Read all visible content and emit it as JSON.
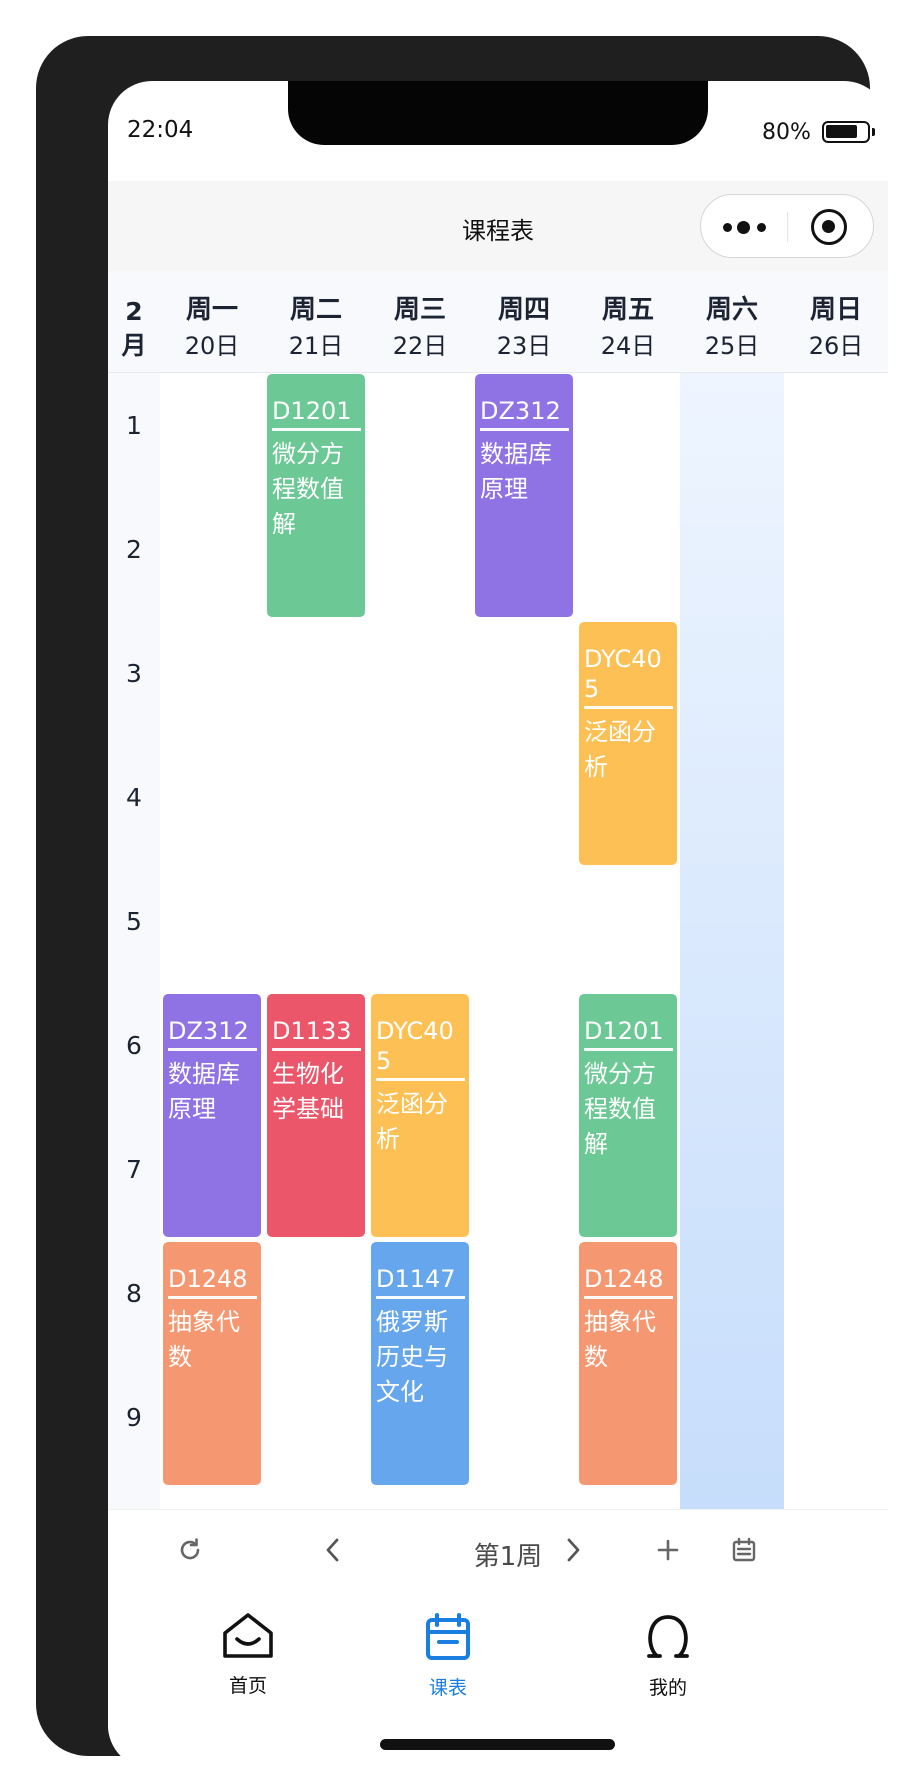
{
  "status": {
    "time": "22:04",
    "battery": "80%",
    "battery_level": 0.8
  },
  "navbar": {
    "title": "课程表"
  },
  "week_header": {
    "month": "2\n月",
    "days": [
      {
        "weekday": "周一",
        "date": "20日"
      },
      {
        "weekday": "周二",
        "date": "21日"
      },
      {
        "weekday": "周三",
        "date": "22日"
      },
      {
        "weekday": "周四",
        "date": "23日"
      },
      {
        "weekday": "周五",
        "date": "24日"
      },
      {
        "weekday": "周六",
        "date": "25日"
      },
      {
        "weekday": "周日",
        "date": "26日"
      }
    ]
  },
  "periods": [
    "1",
    "2",
    "3",
    "4",
    "5",
    "6",
    "7",
    "8",
    "9"
  ],
  "courses": [
    {
      "code": "D1201",
      "name": "微分方程数值解",
      "day": 2,
      "start": 1,
      "span": 2,
      "color": "#6cc894"
    },
    {
      "code": "DZ312",
      "name": "数据库原理",
      "day": 4,
      "start": 1,
      "span": 2,
      "color": "#8f73e4"
    },
    {
      "code": "DYC405",
      "name": "泛函分析",
      "day": 5,
      "start": 3,
      "span": 2,
      "color": "#fdc055"
    },
    {
      "code": "DZ312",
      "name": "数据库原理",
      "day": 1,
      "start": 6,
      "span": 2,
      "color": "#8f73e4"
    },
    {
      "code": "D1133",
      "name": "生物化学基础",
      "day": 2,
      "start": 6,
      "span": 2,
      "color": "#ec566a"
    },
    {
      "code": "DYC405",
      "name": "泛函分析",
      "day": 3,
      "start": 6,
      "span": 2,
      "color": "#fdc055"
    },
    {
      "code": "D1201",
      "name": "微分方程数值解",
      "day": 5,
      "start": 6,
      "span": 2,
      "color": "#6cc894"
    },
    {
      "code": "D1248",
      "name": "抽象代数",
      "day": 1,
      "start": 8,
      "span": 2,
      "color": "#f59872"
    },
    {
      "code": "D1147",
      "name": "俄罗斯历史与文化",
      "day": 3,
      "start": 8,
      "span": 2,
      "color": "#66a6ec"
    },
    {
      "code": "D1248",
      "name": "抽象代数",
      "day": 5,
      "start": 8,
      "span": 2,
      "color": "#f59872"
    }
  ],
  "toolbar": {
    "week_label": "第1周"
  },
  "tabs": [
    {
      "label": "首页",
      "icon": "home-icon",
      "active": false
    },
    {
      "label": "课表",
      "icon": "calendar-icon",
      "active": true
    },
    {
      "label": "我的",
      "icon": "user-icon",
      "active": false
    }
  ],
  "colors": {
    "accent": "#1a7ee0",
    "today_column": "#c6ddfb"
  }
}
